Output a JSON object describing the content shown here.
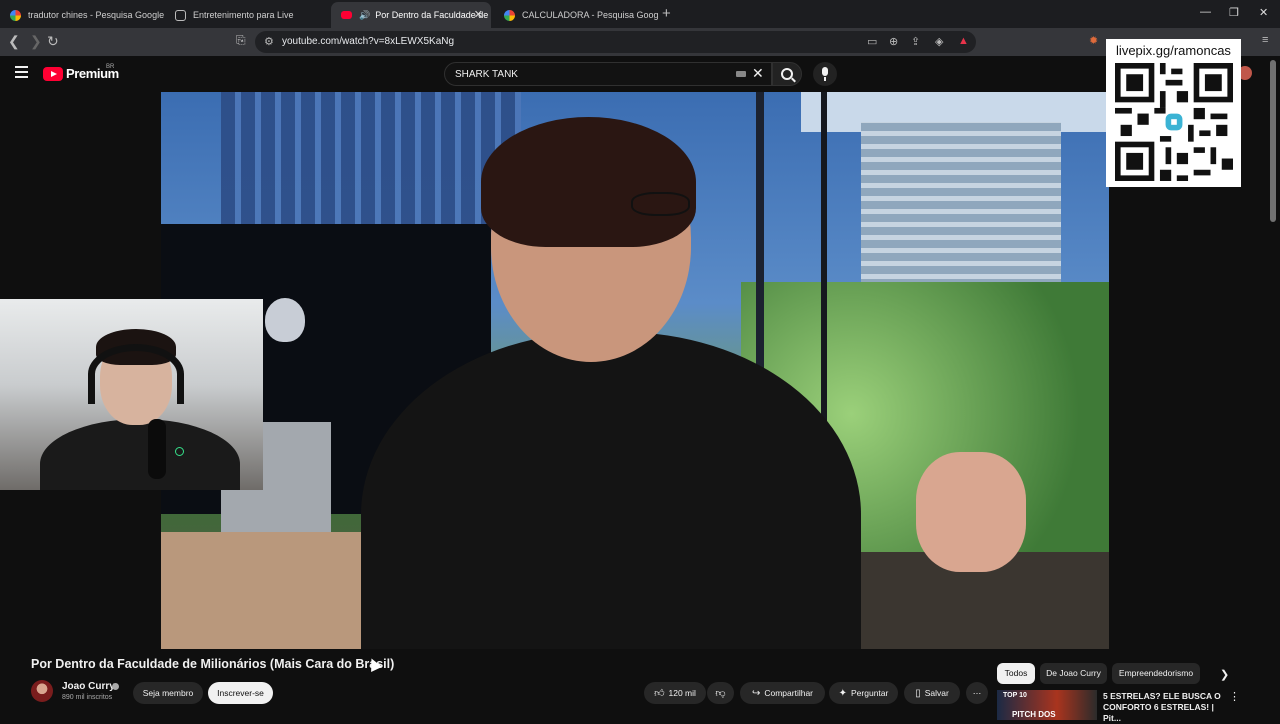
{
  "browser": {
    "tabs": [
      {
        "title": "tradutor chines - Pesquisa Google",
        "icon": "google-icon"
      },
      {
        "title": "Entretenimento para Live",
        "icon": "globe-icon"
      },
      {
        "title": "Por Dentro da Faculdade de Mi",
        "icon": "youtube-icon",
        "audio": "🔊",
        "active": true
      },
      {
        "title": "CALCULADORA - Pesquisa Google",
        "icon": "google-icon"
      }
    ],
    "new_tab": "+",
    "url": "youtube.com/watch?v=8xLEWX5KaNg"
  },
  "youtube": {
    "brand": "Premium",
    "country": "BR",
    "search_value": "SHARK TANK"
  },
  "overlay": {
    "qr_text": "livepix.gg/ramoncas"
  },
  "video": {
    "title": "Por Dentro da Faculdade de Milionários (Mais Cara do Brasil)",
    "channel_name": "Joao Curry",
    "subscribers": "890 mil inscritos",
    "join_label": "Seja membro",
    "subscribe_label": "Inscrever-se",
    "likes": "120 mil",
    "share_label": "Compartilhar",
    "ask_label": "Perguntar",
    "save_label": "Salvar",
    "more_label": "⋯"
  },
  "sidebar": {
    "chips": [
      "Todos",
      "De Joao Curry",
      "Empreendedorismo"
    ],
    "recommendation": {
      "title": "5 ESTRELAS? ELE BUSCA O CONFORTO 6 ESTRELAS! | Pit...",
      "thumb_text": "PITCH DOS",
      "thumb_badge": "TOP 10"
    }
  },
  "colors": {
    "background": "#0f0f0f",
    "accent": "#ff0033",
    "text": "#f1f1f1",
    "secondary_text": "#aaaaaa",
    "chip": "#272727"
  }
}
